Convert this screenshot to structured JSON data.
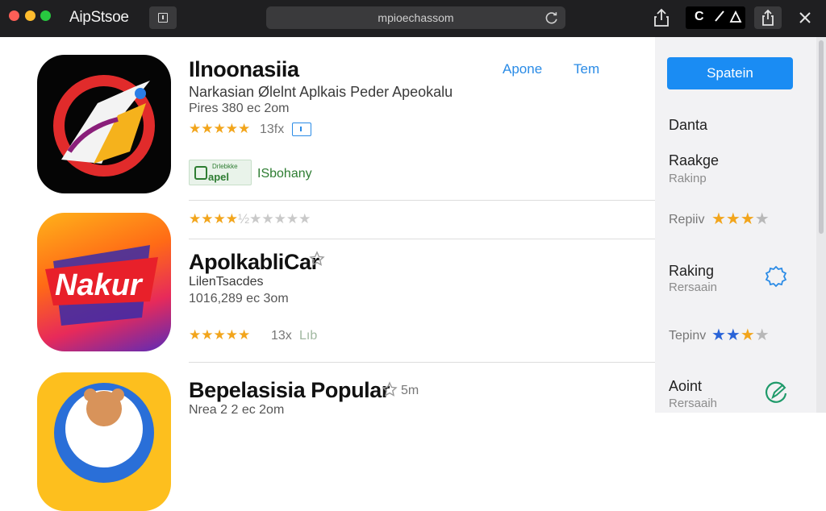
{
  "window": {
    "app_title": "AipStsoe",
    "url": "mpioechassom"
  },
  "apps": [
    {
      "title": "Ilnoonasiia",
      "subtitle": "Narkasian Ølelnt Aplkais Peder Apeokalu",
      "meta": "Pires 380 ec 2om",
      "rating_stars": 5,
      "rating_count": "13fx",
      "tab_links": [
        "Apone",
        "Tem"
      ],
      "badge": {
        "top_text": "Drlebkke",
        "main_text": "apel"
      },
      "company": "ISbohany"
    },
    {
      "title": "ApolkabliCar",
      "subtitle": "LilenTsacdes",
      "meta": "1016,289 ec 3om",
      "rating_stars": 4.5,
      "rating_count": "13x",
      "extra": "Lıb"
    },
    {
      "title": "Bepelasisia Popular",
      "subtitle": "Nrea 2 2 ec 2om",
      "extra": "5m"
    }
  ],
  "separator_rating_stars": 4.5,
  "sidebar": {
    "button_label": "Spatein",
    "section1": {
      "heading": "Danta"
    },
    "section2": {
      "heading": "Raakge",
      "sub": "Rakinp"
    },
    "rating_row1": {
      "label": "Repiiv",
      "stars": 3,
      "color": "#f2a51c"
    },
    "section3": {
      "heading": "Raking",
      "sub": "Rersaain"
    },
    "rating_row2": {
      "label": "Tepinv",
      "stars": 3,
      "color": "#2a64d8"
    },
    "section4": {
      "heading": "Aoint",
      "sub": "Rersaaih"
    }
  },
  "colors": {
    "accent_blue": "#1a8cf3",
    "star_gold": "#f2a51c",
    "green": "#2e7d32"
  },
  "icons": {
    "share": "share-icon",
    "reload": "reload-icon",
    "close": "close-icon",
    "gear": "gear-icon",
    "edit": "edit-icon"
  }
}
